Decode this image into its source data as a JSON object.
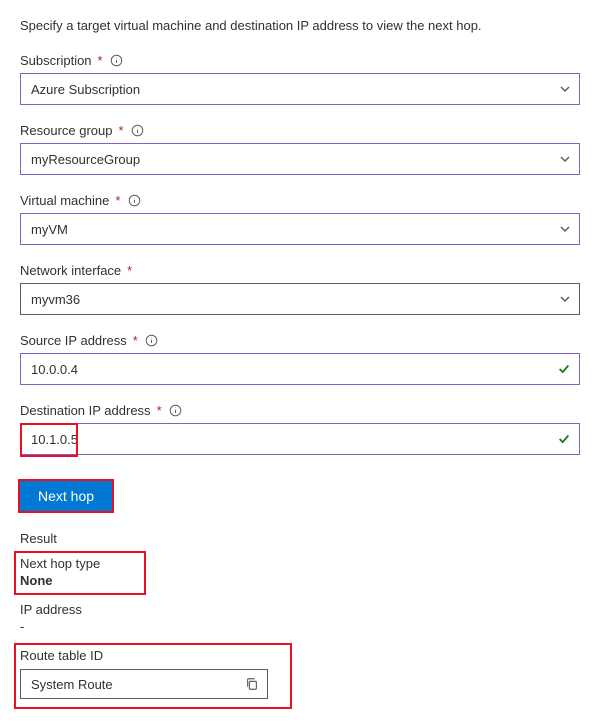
{
  "instruction": "Specify a target virtual machine and destination IP address to view the next hop.",
  "fields": {
    "subscription": {
      "label": "Subscription",
      "value": "Azure Subscription"
    },
    "resourceGroup": {
      "label": "Resource group",
      "value": "myResourceGroup"
    },
    "virtualMachine": {
      "label": "Virtual machine",
      "value": "myVM"
    },
    "networkInterface": {
      "label": "Network interface",
      "value": "myvm36"
    },
    "sourceIp": {
      "label": "Source IP address",
      "value": "10.0.0.4"
    },
    "destinationIp": {
      "label": "Destination IP address",
      "value": "10.1.0.5"
    }
  },
  "button": {
    "nextHop": "Next hop"
  },
  "result": {
    "heading": "Result",
    "nextHopType": {
      "label": "Next hop type",
      "value": "None"
    },
    "ipAddress": {
      "label": "IP address",
      "value": "-"
    },
    "routeTableId": {
      "label": "Route table ID",
      "value": "System Route"
    }
  }
}
